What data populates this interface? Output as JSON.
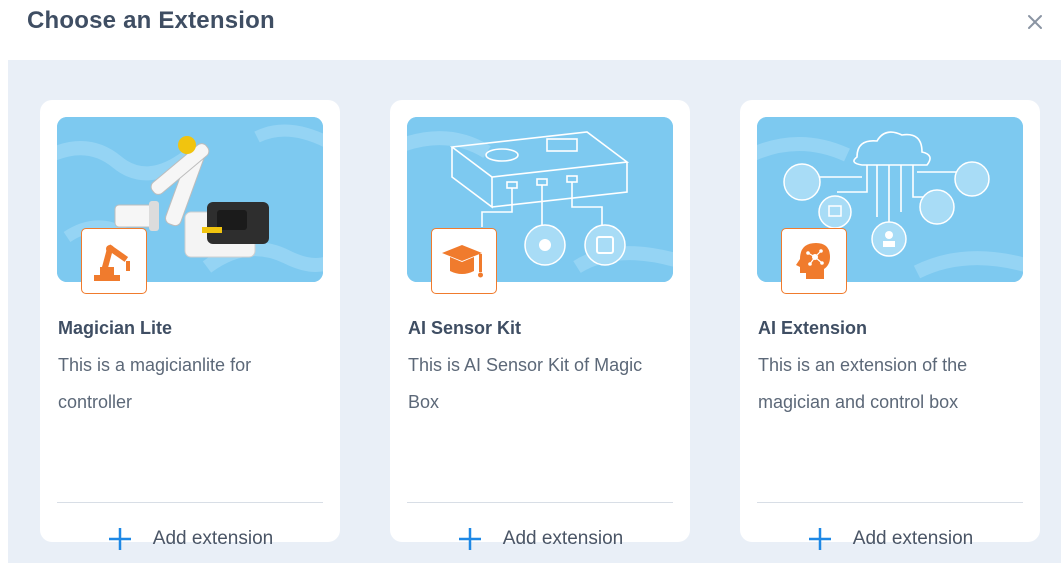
{
  "dialog": {
    "title": "Choose an Extension",
    "close_symbol": "×"
  },
  "extensions": [
    {
      "title": "Magician Lite",
      "description": "This is a magicianlite for controller",
      "icon": "robot-arm-icon",
      "add_label": "Add extension"
    },
    {
      "title": "AI Sensor Kit",
      "description": "This is AI Sensor Kit of Magic Box",
      "icon": "graduation-cap-icon",
      "add_label": "Add extension"
    },
    {
      "title": "AI Extension",
      "description": "This is an extension of the magician and control box",
      "icon": "ai-head-icon",
      "add_label": "Add extension"
    }
  ],
  "colors": {
    "accent": "#1e88e5",
    "badge_orange": "#f07b2d",
    "thumb_blue": "#7dc9f0",
    "background": "#e9eff7"
  }
}
